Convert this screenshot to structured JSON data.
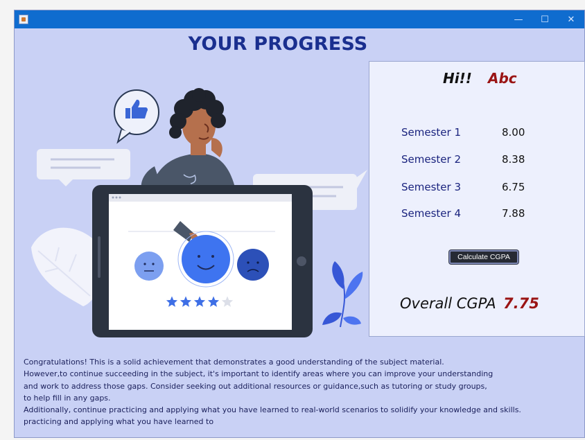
{
  "window": {
    "controls": {
      "minimize": "—",
      "maximize": "☐",
      "close": "✕"
    }
  },
  "heading": "YOUR PROGRESS",
  "illustration": {
    "rating_stars_filled": 4,
    "rating_stars_total": 5
  },
  "panel": {
    "greeting": "Hi!!",
    "username": "Abc",
    "semesters": [
      {
        "label": "Semester 1",
        "value": "8.00"
      },
      {
        "label": "Semester 2",
        "value": "8.38"
      },
      {
        "label": "Semester 3",
        "value": "6.75"
      },
      {
        "label": "Semester 4",
        "value": "7.88"
      }
    ],
    "calculate_label": "Calculate  CGPA",
    "cgpa_label": "Overall CGPA",
    "cgpa_value": "7.75"
  },
  "message": {
    "lines": [
      "Congratulations!  This is a solid achievement that demonstrates a good understanding of the subject material.",
      "However,to continue succeeding in the subject, it's important to identify areas where you can improve your understanding",
      "and work to address those gaps.  Consider seeking out additional resources or guidance,such as tutoring or study groups,",
      "to help fill in any gaps.",
      "Additionally, continue practicing and applying what you have learned to real-world scenarios to solidify your knowledge and skills.",
      "practicing and applying what you have learned to"
    ]
  },
  "colors": {
    "background": "#c9d1f5",
    "titlebar": "#0f6ccf",
    "heading": "#1a2f8f",
    "accent_red": "#9a1414",
    "semester_label": "#1a237e"
  }
}
